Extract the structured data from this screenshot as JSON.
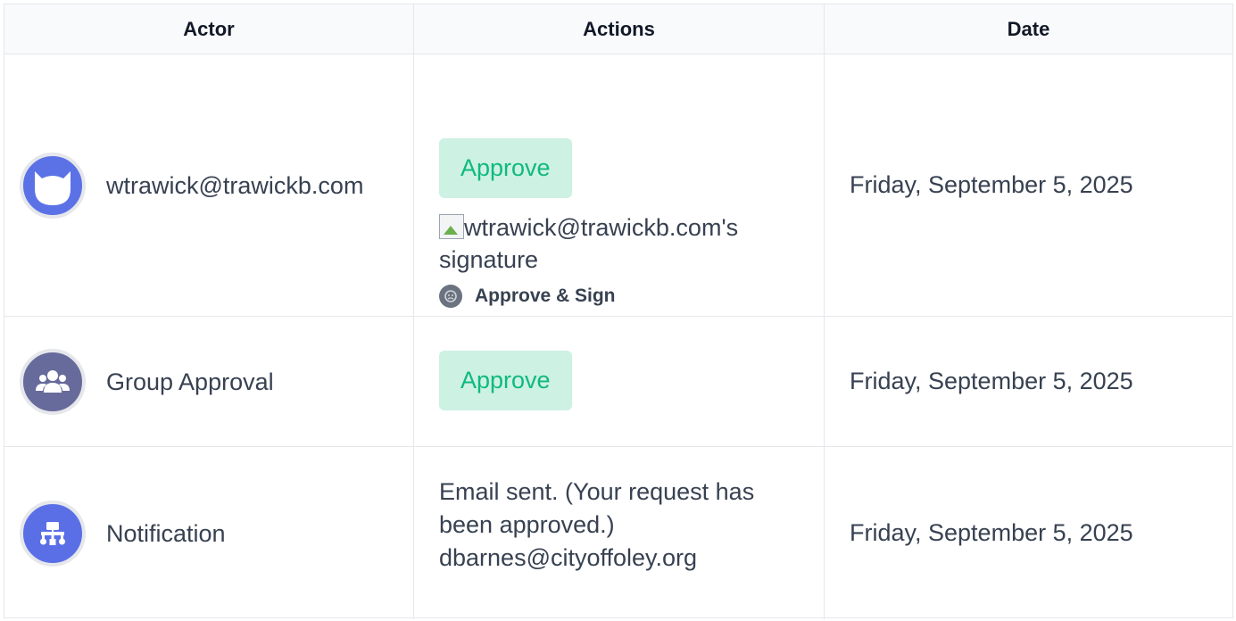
{
  "headers": {
    "actor": "Actor",
    "actions": "Actions",
    "date": "Date"
  },
  "rows": [
    {
      "actor": {
        "name": "wtrawick@trawickb.com",
        "avatar_icon": "cat-face-icon",
        "avatar_color": "#5b72e6"
      },
      "approve_label": "Approve",
      "signature_alt": "wtrawick@trawickb.com's signature",
      "approve_sign_label": "Approve & Sign",
      "date": "Friday, September 5, 2025"
    },
    {
      "actor": {
        "name": "Group Approval",
        "avatar_icon": "users-group-icon",
        "avatar_color": "#676b9b"
      },
      "approve_label": "Approve",
      "date": "Friday, September 5, 2025"
    },
    {
      "actor": {
        "name": "Notification",
        "avatar_icon": "sitemap-icon",
        "avatar_color": "#5a6fe6"
      },
      "notification_text": "Email sent. (Your request has been approved.) dbarnes@cityoffoley.org",
      "date": "Friday, September 5, 2025"
    }
  ],
  "colors": {
    "approve_bg": "#cdf1e3",
    "approve_text": "#10b981",
    "border": "#e5e7eb"
  }
}
